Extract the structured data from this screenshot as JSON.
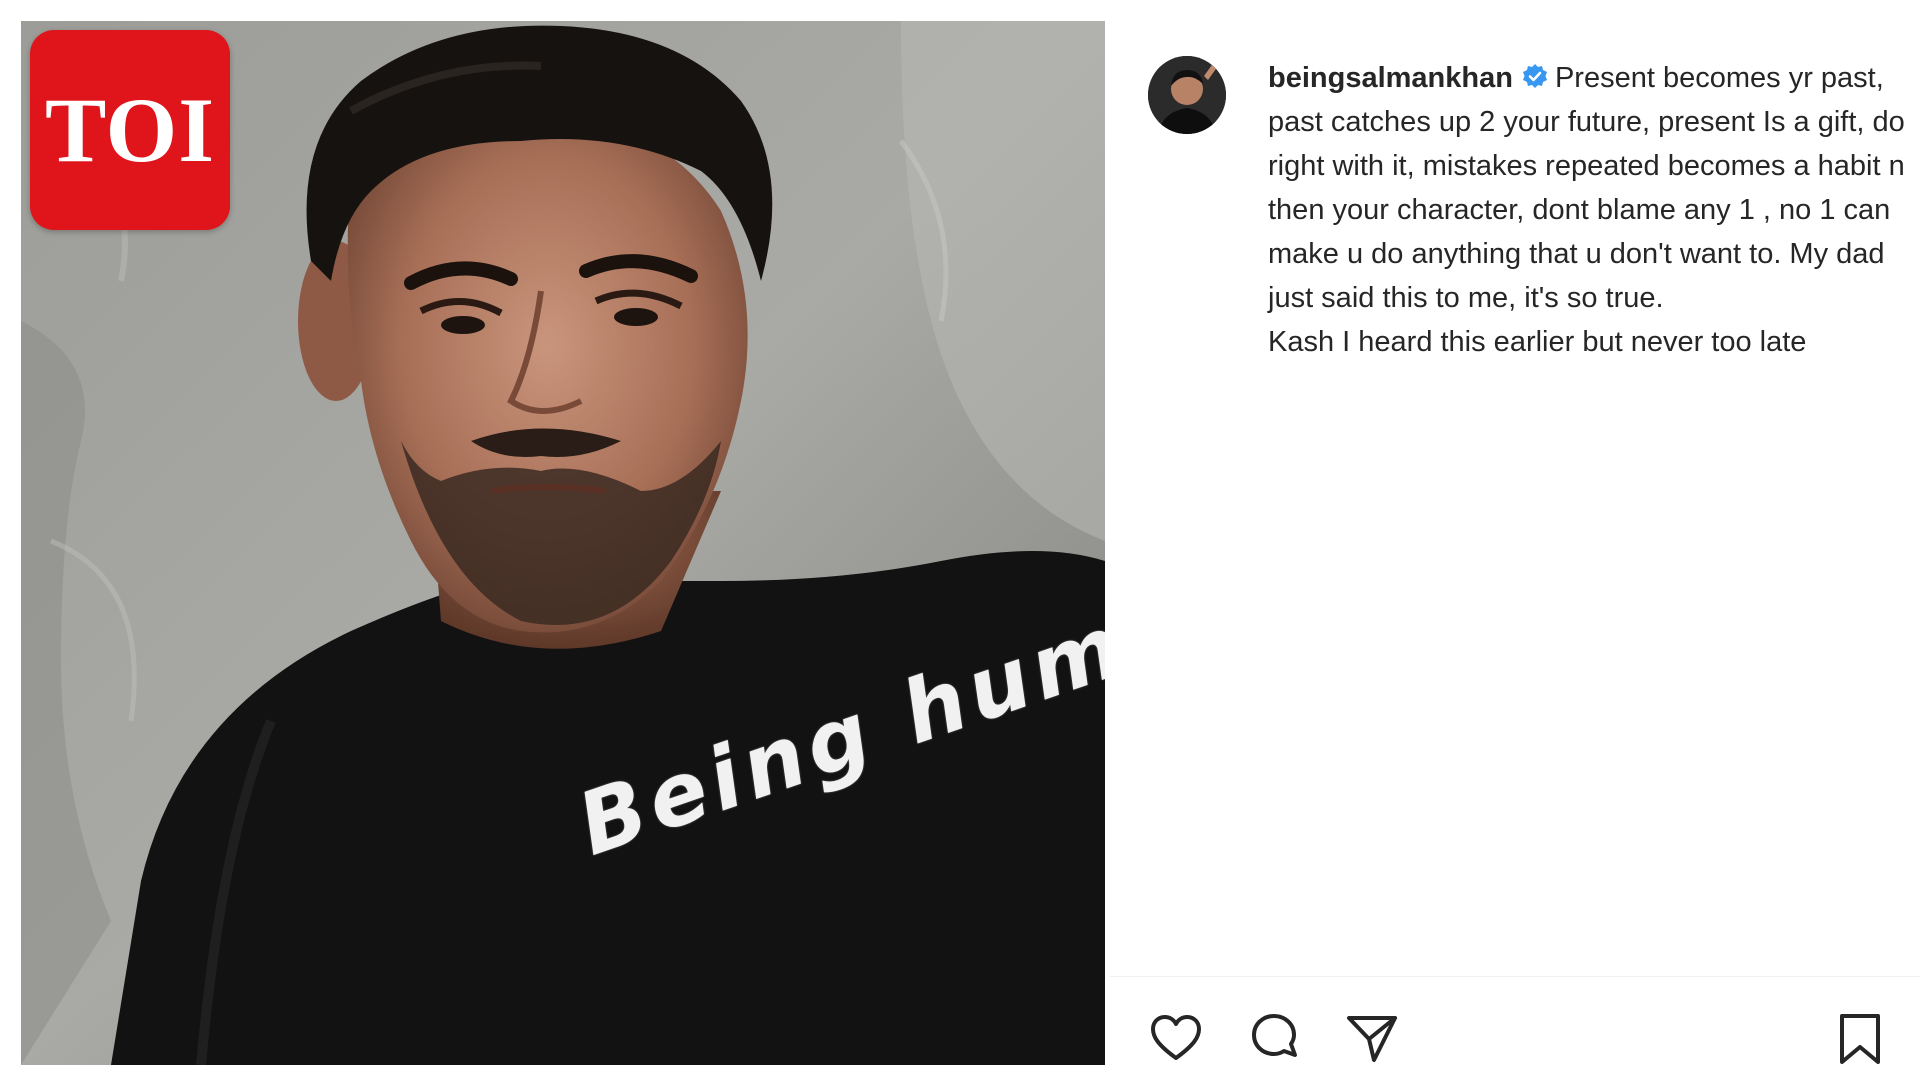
{
  "badge": {
    "text": "TOI",
    "color": "#e0151b"
  },
  "photo": {
    "shirt_print": "Being human"
  },
  "post": {
    "username": "beingsalmankhan",
    "verified": true,
    "caption_lines": [
      "Present becomes yr past, past catches up 2 your future, present Is a gift, do right with it, mistakes repeated becomes a habit n then your character, dont blame any 1 , no 1 can make u do anything that u don't want to. My dad just said this to me, it's so true.",
      "Kash I heard this earlier but never too late"
    ]
  },
  "actions": {
    "like": "heart-icon",
    "comment": "comment-icon",
    "share": "share-icon",
    "save": "bookmark-icon"
  },
  "colors": {
    "text": "#262626",
    "verified": "#3897f0",
    "icon": "#262626"
  }
}
